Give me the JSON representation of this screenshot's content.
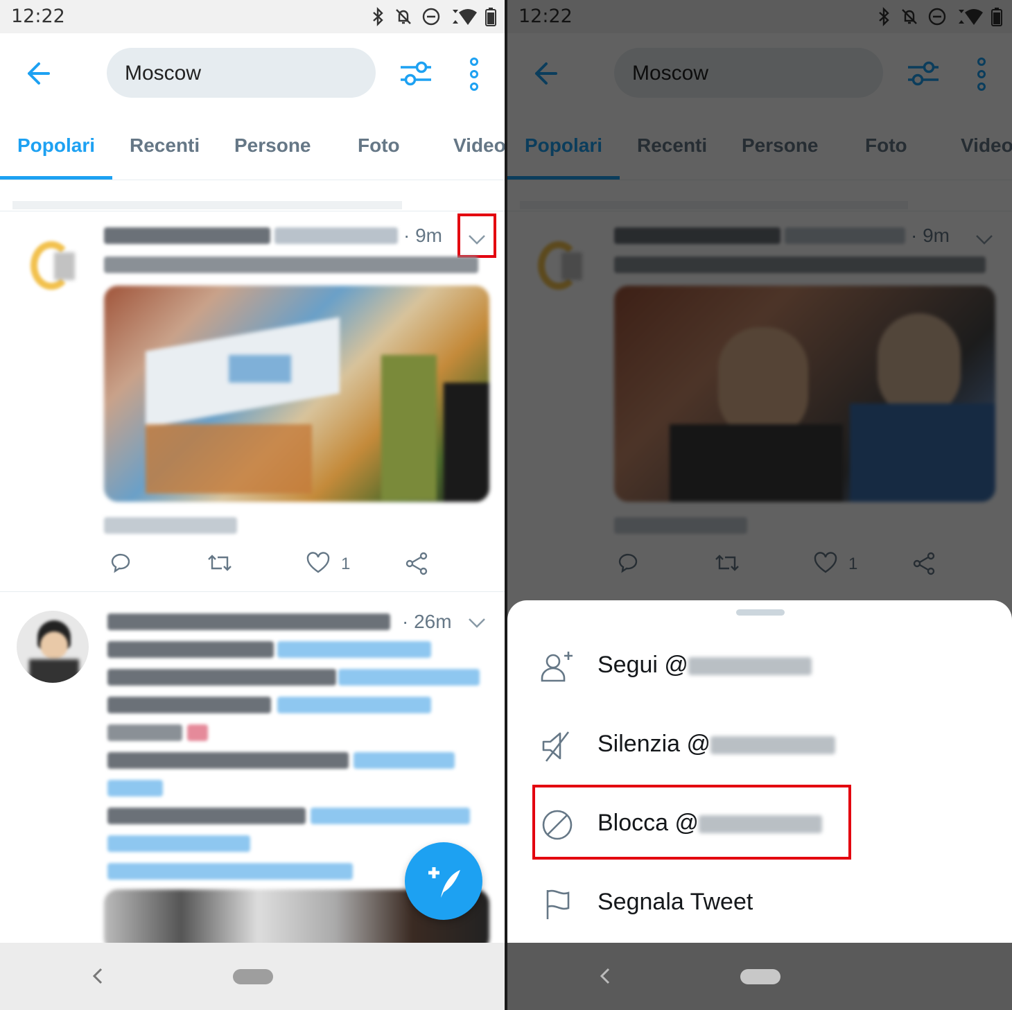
{
  "status": {
    "time": "12:22"
  },
  "search": {
    "query": "Moscow"
  },
  "tabs": [
    {
      "label": "Popolari"
    },
    {
      "label": "Recenti"
    },
    {
      "label": "Persone"
    },
    {
      "label": "Foto"
    },
    {
      "label": "Video"
    }
  ],
  "tweets": [
    {
      "time": "· 9m",
      "likes": "1"
    },
    {
      "time": "· 26m"
    }
  ],
  "menu": {
    "items": [
      {
        "label": "Segui @",
        "icon": "add-person-icon"
      },
      {
        "label": "Silenzia @",
        "icon": "mute-icon"
      },
      {
        "label": "Blocca @",
        "icon": "block-icon"
      },
      {
        "label": "Segnala Tweet",
        "icon": "flag-icon"
      }
    ]
  },
  "colors": {
    "accent": "#1da1f2",
    "highlight": "#e3000f",
    "text_secondary": "#657786"
  }
}
